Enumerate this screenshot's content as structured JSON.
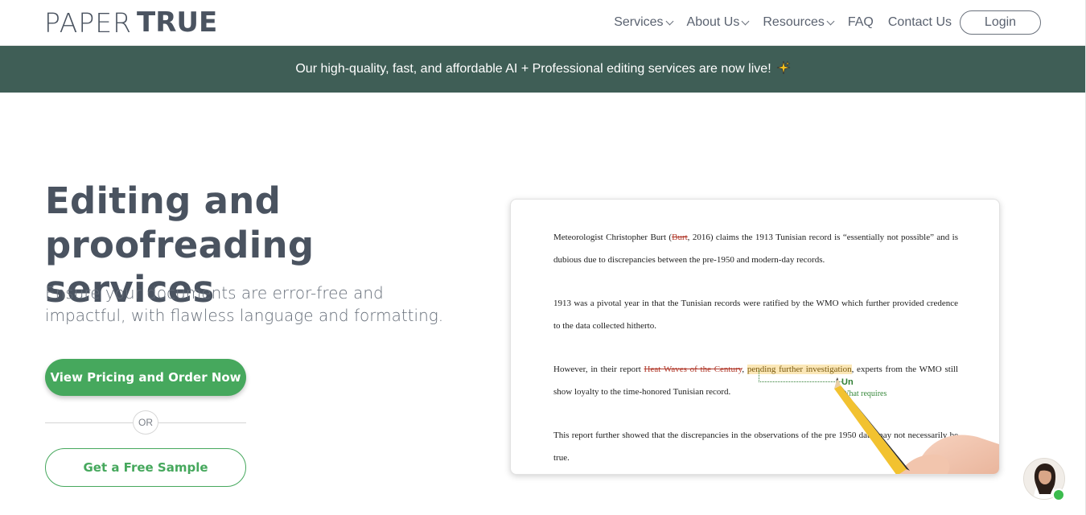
{
  "header": {
    "logo_left": "PAPER",
    "logo_right": "TRUE",
    "nav": [
      "Services",
      "About Us",
      "Resources",
      "FAQ",
      "Contact Us"
    ],
    "login_label": "Login"
  },
  "banner": {
    "text": "Our high-quality, fast, and affordable AI + Professional editing services are now live!",
    "icon": "sparkles-icon"
  },
  "hero": {
    "title_line1": "Editing and",
    "title_line2": "proofreading services",
    "subtitle_line1": "Ensure your documents are error-free and",
    "subtitle_line2": "impactful, with flawless language and formatting.",
    "primary_cta": "View Pricing and Order Now",
    "or_label": "OR",
    "secondary_cta": "Get a Free Sample"
  },
  "document": {
    "p1_a": "Meteorologist Christopher Burt (",
    "p1_strike": "Burt",
    "p1_b": ", 2016) claims the 1913 Tunisian record is “essentially not possible” and is dubious due to discrepancies between the pre-1950 and modern-day records.",
    "p2": "1913 was a pivotal year in that the Tunisian records were ratified by the WMO which further provided credence to the data collected hitherto.",
    "p3_a": "However, in their report ",
    "p3_strike": "Heat Waves of the Century",
    "p3_b": ", ",
    "p3_highlight": "pending further investigation",
    "p3_c": ", experts from the WMO still show loyalty to the time-honored Tunisian record.",
    "annotation_1": "Un",
    "annotation_2": "What requires",
    "p4": "This report further showed that the discrepancies in the observations of the pre 1950 data may not necessarily be true."
  },
  "colors": {
    "brand_green": "#46a85d",
    "banner_bg": "#3f5e56",
    "text_dark": "#4a5360"
  }
}
